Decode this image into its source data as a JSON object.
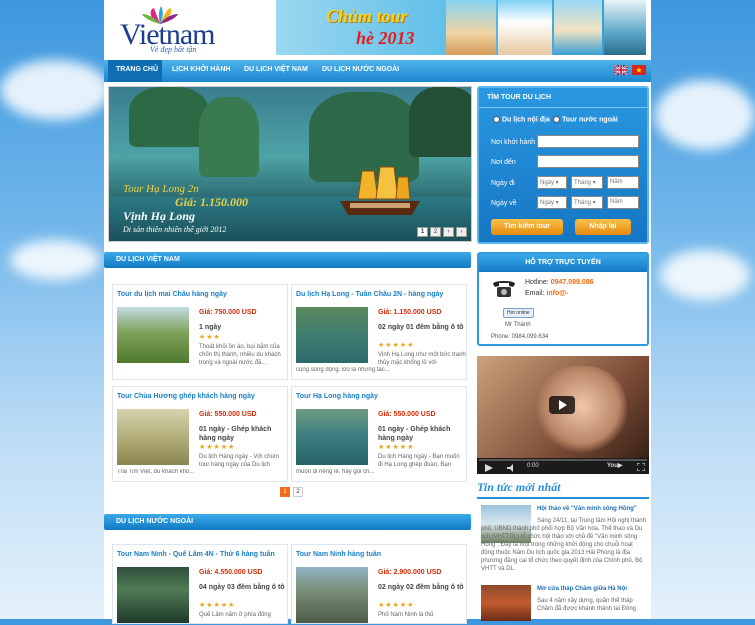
{
  "header": {
    "logo_text": "Vietnam",
    "logo_tagline": "Vẻ đẹp bất tận",
    "banner_line1": "Chùm tour",
    "banner_line2": "hè 2013"
  },
  "nav": {
    "items": [
      "TRANG CHỦ",
      "LỊCH KHỞI HÀNH",
      "DU LỊCH VIỆT NAM",
      "DU LỊCH NƯỚC NGOÀI"
    ]
  },
  "slider": {
    "caption1": "Tour Hạ Long 2n",
    "caption2": "Giá: 1.150.000",
    "caption3": "Vịnh Hạ Long",
    "caption4": "Di sản thiên nhiên thế giới 2012",
    "pages": [
      "1",
      "2",
      "‹",
      "›"
    ]
  },
  "search": {
    "title": "TÌM TOUR DU LỊCH",
    "radio_domestic": "Du lịch nội địa",
    "radio_foreign": "Tour nước ngoài",
    "from_label": "Nơi khởi hành",
    "to_label": "Nơi đến",
    "date_from_label": "Ngày đi",
    "date_to_label": "Ngày về",
    "day_placeholder": "Ngày",
    "month_placeholder": "Tháng",
    "year_placeholder": "Năm",
    "search_button": "Tìm kiếm tour",
    "reset_button": "Nhập lại"
  },
  "vn_section": {
    "title": "DU LỊCH VIỆT NAM",
    "tours": [
      {
        "title": "Tour du lịch mai Châu hàng ngày",
        "price": "Giá: 750.000 USD",
        "duration": "1 ngày",
        "desc": "Thoát khỏi ồn ào, bụi bặm của chốn thị thành, nhiều du khách trong và ngoài nước đã...",
        "extra": ""
      },
      {
        "title": "Du lịch Hạ Long - Tuần Châu 2N - hàng ngày",
        "price": "Giá: 1.150.000 USD",
        "duration": "02 ngày 01 đêm bằng ô tô",
        "desc": "Vịnh Hạ Long như một bức tranh thủy mặc khổng lồ với",
        "extra": "cùng sống động. Đó là những tác..."
      },
      {
        "title": "Tour Chùa Hương ghép khách hàng ngày",
        "price": "Giá: 550.000 USD",
        "duration": "01 ngày - Ghép khách hàng ngày",
        "desc": "Du lịch Hàng ngày - Với chùm tour hàng ngày của Du lịch",
        "extra": "Trải Tim Việt, du khách khó..."
      },
      {
        "title": "Tour Hạ Long hàng ngày",
        "price": "Giá: 550.000 USD",
        "duration": "01 ngày - Ghép khách hàng ngày",
        "desc": "Du lịch Hàng ngày - Bạn muốn đi Hạ Long ghép đoàn, Bạn",
        "extra": "muốn đi riêng lẻ, hãy gọi ch..."
      }
    ],
    "pages": [
      "1",
      "2"
    ]
  },
  "intl_section": {
    "title": "DU LỊCH NƯỚC NGOÀI",
    "tours": [
      {
        "title": "Tour Nam Ninh - Quế Lâm 4N - Thứ 6 hàng tuần",
        "price": "Giá: 4.550.000 USD",
        "duration": "04 ngày 03 đêm bằng ô tô",
        "desc": "Quế Lâm nằm ở phía đông"
      },
      {
        "title": "Tour Nam Ninh hàng tuần",
        "price": "Giá: 2.900.000 USD",
        "duration": "02 ngày 02 đêm bằng ô tô",
        "desc": "Phố Nam Ninh là thủ"
      }
    ]
  },
  "support": {
    "title": "HỖ TRỢ TRỰC TUYẾN",
    "hotline_label": "Hotline:",
    "hotline": "0947.099.086",
    "email_label": "Email:",
    "email": "info@-",
    "status": "Hot online",
    "name": "Mr Thành",
    "phone": "Phone: 0984.099.634"
  },
  "video": {
    "time": "0:00"
  },
  "news": {
    "title": "Tin tức mới nhất",
    "items": [
      {
        "title": "Hội thảo về \"Văn minh sông Hồng\"",
        "text": "Sáng 24/11, tại Trung tâm Hội nghị thành phố, UBND thành phố phối hợp Bộ Văn hóa, Thể thao và Du lịch (VHTTDL) tổ chức hội thảo với chủ đề \"Văn minh sông Hồng\". Đây là một trong những khởi động cho chuỗi hoạt động thuộc Năm Du lịch quốc gia 2013 Hải Phòng là địa phương đăng cai tổ chức theo quyết định của Chính phủ, Bộ VHTT và DL."
      },
      {
        "title": "Mở cửa tháp Chăm giữa Hà Nội",
        "text": "Sau 4 năm xây dựng, quần thể tháp Chăm đã được khánh thành tại Đồng"
      }
    ]
  }
}
